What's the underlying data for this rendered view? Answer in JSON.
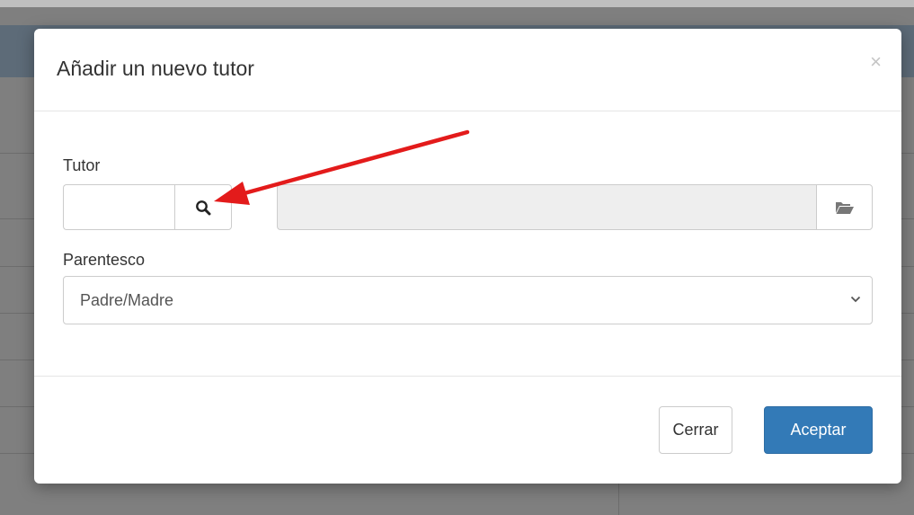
{
  "modal": {
    "title": "Añadir un nuevo tutor",
    "close_label": "×"
  },
  "form": {
    "tutor_label": "Tutor",
    "tutor_value": "",
    "tutor_name_value": "",
    "parentesco_label": "Parentesco",
    "parentesco_selected": "Padre/Madre"
  },
  "icons": {
    "search": "search-icon",
    "folder": "folder-open-icon",
    "chevron": "chevron-down-icon",
    "close": "close-icon"
  },
  "footer": {
    "cerrar_label": "Cerrar",
    "aceptar_label": "Aceptar"
  },
  "colors": {
    "primary": "#337ab7",
    "annotation_arrow": "#e31b1b",
    "readonly_field": "#eeeeee"
  }
}
